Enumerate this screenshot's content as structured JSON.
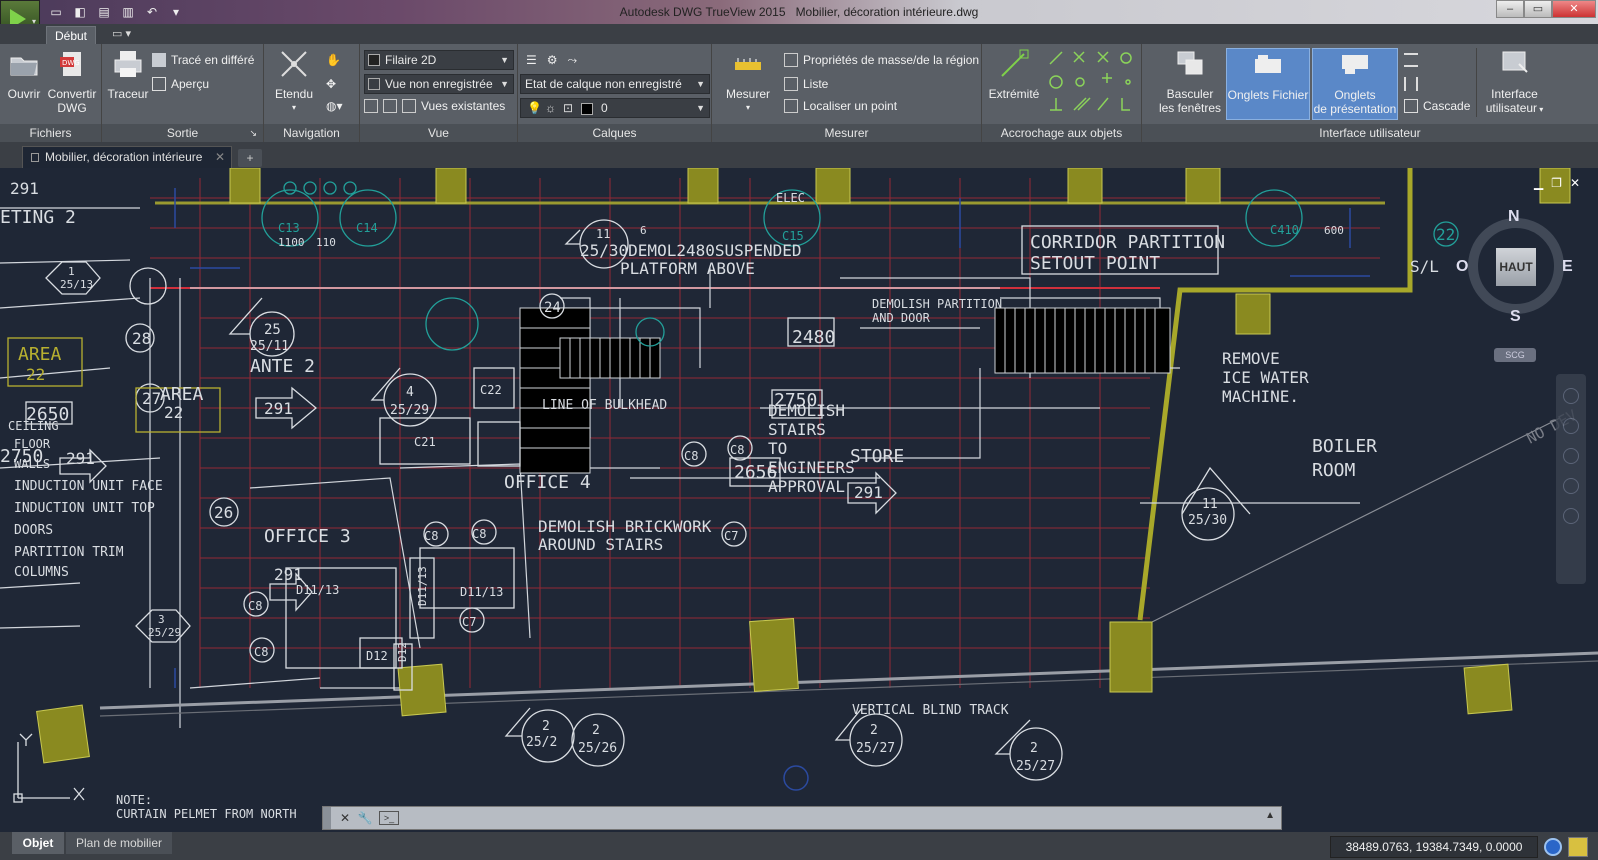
{
  "window": {
    "title": "Autodesk DWG TrueView 2015",
    "document": "Mobilier, décoration intérieure.dwg"
  },
  "ribbon": {
    "tab_active": "Début",
    "panels": {
      "fichiers": {
        "title": "Fichiers",
        "ouvrir": "Ouvrir",
        "convertir_line1": "Convertir",
        "convertir_line2": "DWG"
      },
      "sortie": {
        "title": "Sortie",
        "traceur": "Traceur",
        "trace_differe": "Tracé en différé",
        "apercu": "Aperçu"
      },
      "navigation": {
        "title": "Navigation",
        "etendu": "Etendu"
      },
      "vue": {
        "title": "Vue",
        "visual_style": "Filaire 2D",
        "named_view": "Vue non enregistrée",
        "vues_existantes": "Vues existantes"
      },
      "calques": {
        "title": "Calques",
        "layer_state": "Etat de calque non enregistré",
        "current_layer": "0"
      },
      "mesurer": {
        "title": "Mesurer",
        "mesurer": "Mesurer",
        "proprietes": "Propriétés de masse/de la région",
        "liste": "Liste",
        "localiser": "Localiser un point"
      },
      "accrochage": {
        "title": "Accrochage aux objets",
        "extremite": "Extrémité"
      },
      "interface": {
        "title": "Interface utilisateur",
        "basculer_line1": "Basculer",
        "basculer_line2": "les fenêtres",
        "onglets_fichier": "Onglets Fichier",
        "onglets_pres_line1": "Onglets",
        "onglets_pres_line2": "de présentation",
        "cascade": "Cascade",
        "interface_line1": "Interface",
        "interface_line2": "utilisateur"
      }
    }
  },
  "doc_tab": {
    "label": "Mobilier, décoration intérieure",
    "new_tab": "+"
  },
  "drawing": {
    "labels": {
      "corridor_partition": "CORRIDOR PARTITION",
      "setout_point": "SETOUT POINT",
      "demolish_partition": "DEMOLISH PARTITION",
      "and_door": "AND DOOR",
      "remove": "REMOVE",
      "ice_water": "ICE WATER",
      "machine": "MACHINE.",
      "boiler": "BOILER",
      "room": "ROOM",
      "demolish_suspended": "25/30DEMOL2480SUSPENDED",
      "platform_above": "PLATFORM ABOVE",
      "line_of_bulkhead": "LINE OF BULKHEAD",
      "demolish_stairs": "DEMOLISH",
      "stairs": "STAIRS",
      "to": "TO",
      "engineers": "ENGINEERS",
      "approval": "APPROVAL",
      "store": "STORE",
      "office4": "OFFICE 4",
      "demolish_brickwork": "DEMOLISH BRICKWORK",
      "around_stairs": "AROUND STAIRS",
      "office3": "OFFICE 3",
      "area22a": "AREA",
      "area22b": "22",
      "area22c": "AREA",
      "area22d": "22",
      "ante2": "ANTE 2",
      "eting2": "ETING 2",
      "vertical_blind": "VERTICAL BLIND TRACK",
      "note": "NOTE:",
      "curtain": "CURTAIN PELMET FROM NORTH",
      "no_dev": "NO DEV",
      "elec": "ELEC",
      "legend_floor": "FLOOR",
      "legend_walls": "WALLS",
      "legend_ind_face": "INDUCTION UNIT FACE",
      "legend_ind_top": "INDUCTION UNIT TOP",
      "legend_doors": "DOORS",
      "legend_partition": "PARTITION TRIM",
      "legend_columns": "COLUMNS",
      "legend_ceiling": "CEILING",
      "dim2480a": "2480",
      "dim2750": "2750",
      "dim2656": "2656",
      "dim2650": "2650",
      "dim2750b": "2750",
      "num291a": "291",
      "num291b": "291",
      "num291c": "291",
      "num291d": "291",
      "num291e": "291",
      "num28": "28",
      "num27": "27",
      "num26": "26",
      "num24": "24",
      "num22": "22",
      "c22": "C22",
      "c21": "C21",
      "c8a": "C8",
      "c8b": "C8",
      "c8c": "C8",
      "c8d": "C8",
      "c8e": "C8",
      "c8f": "C8",
      "c7a": "C7",
      "c7b": "C7",
      "d11_13a": "D11/13",
      "d11_13b": "D11/13",
      "d11_13c": "D11/13",
      "d12a": "D12",
      "d12b": "D12",
      "c410": "C410",
      "c15": "C15",
      "c13": "C13",
      "c14": "C14",
      "sec_11_2530": "11",
      "sec_11_2530b": "25/30",
      "sec_4_2529": "4",
      "sec_4_2529b": "25/29",
      "sec_1_2513": "1",
      "sec_1_2513b": "25/13",
      "sec_3_2529": "3",
      "sec_3_2529b": "25/29",
      "sec_25_2511": "25",
      "sec_25_2511b": "25/11",
      "sec_2_2526": "2",
      "sec_2_2526b": "25/26",
      "sec_2_2527a": "2",
      "sec_2_2527ab": "25/27",
      "sec_2_2527b": "2",
      "sec_2_2527bb": "25/27",
      "sec_2_252": "2",
      "sec_2_252b": "25/2",
      "sec_11_top": "11",
      "sec_6": "6",
      "d1100": "1100",
      "d110": "110",
      "d600": "600",
      "sl": "S/L"
    },
    "viewcube": {
      "face": "HAUT",
      "north": "N",
      "south": "S",
      "east": "E",
      "west": "O",
      "wcs": "SCG"
    }
  },
  "statusbar": {
    "tab_objet": "Objet",
    "tab_plan": "Plan de mobilier",
    "coordinates": "38489.0763, 19384.7349, 0.0000"
  },
  "colors": {
    "canvas_bg": "#1f2736",
    "grid_red": "#b0303c",
    "line_white": "#d9dde2",
    "accent_yellow": "#b0b030",
    "cyan": "#2aa8a0"
  }
}
